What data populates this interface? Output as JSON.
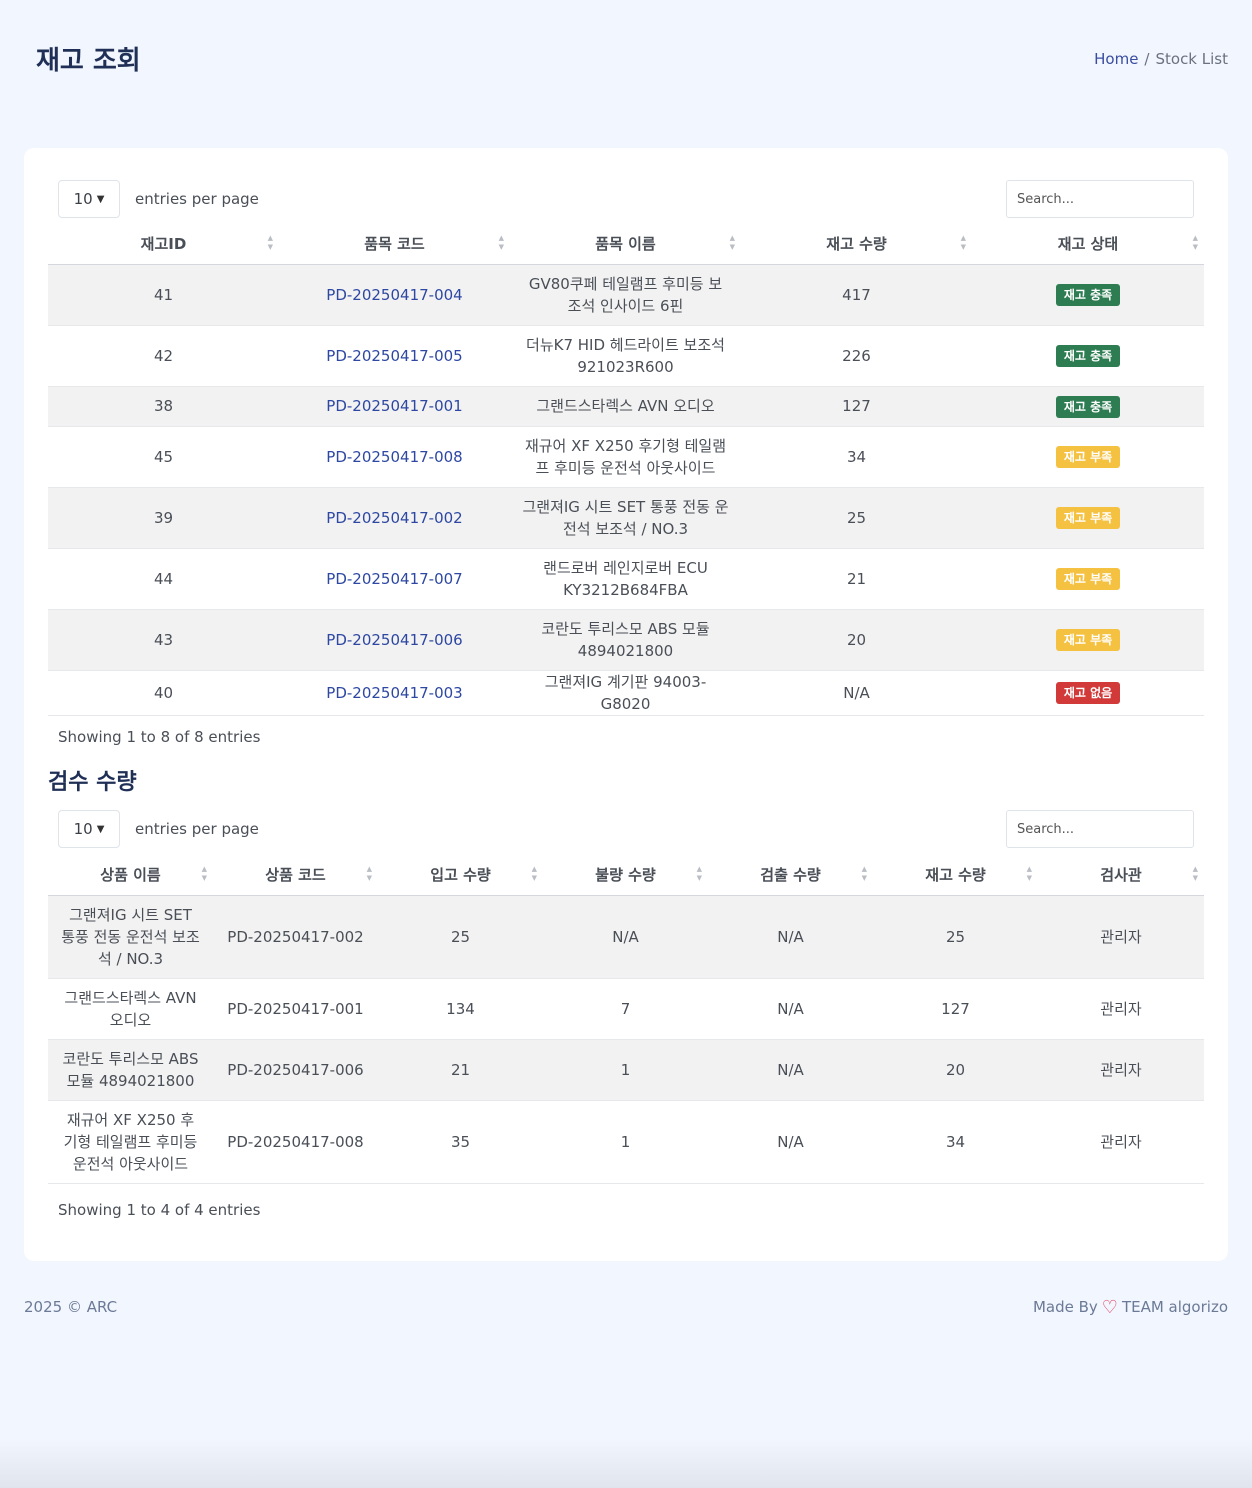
{
  "header": {
    "title": "재고 조회",
    "breadcrumb": {
      "home": "Home",
      "separator": "/",
      "current": "Stock List"
    }
  },
  "stock_table": {
    "length_value": "10",
    "length_label": "entries per page",
    "search_placeholder": "Search...",
    "columns": [
      "재고ID",
      "품목 코드",
      "품목 이름",
      "재고 수량",
      "재고 상태"
    ],
    "rows": [
      {
        "id": "41",
        "code": "PD-20250417-004",
        "name": "GV80쿠페 테일램프 후미등 보조석 인사이드 6핀",
        "qty": "417",
        "status": "재고 충족",
        "status_type": "ok"
      },
      {
        "id": "42",
        "code": "PD-20250417-005",
        "name": "더뉴K7 HID 헤드라이트 보조석 921023R600",
        "qty": "226",
        "status": "재고 충족",
        "status_type": "ok"
      },
      {
        "id": "38",
        "code": "PD-20250417-001",
        "name": "그랜드스타렉스 AVN 오디오",
        "qty": "127",
        "status": "재고 충족",
        "status_type": "ok"
      },
      {
        "id": "45",
        "code": "PD-20250417-008",
        "name": "재규어 XF X250 후기형 테일램프 후미등 운전석 아웃사이드",
        "qty": "34",
        "status": "재고 부족",
        "status_type": "low"
      },
      {
        "id": "39",
        "code": "PD-20250417-002",
        "name": "그랜져IG 시트 SET 통풍 전동 운전석 보조석 / NO.3",
        "qty": "25",
        "status": "재고 부족",
        "status_type": "low"
      },
      {
        "id": "44",
        "code": "PD-20250417-007",
        "name": "랜드로버 레인지로버 ECU KY3212B684FBA",
        "qty": "21",
        "status": "재고 부족",
        "status_type": "low"
      },
      {
        "id": "43",
        "code": "PD-20250417-006",
        "name": "코란도 투리스모 ABS 모듈 4894021800",
        "qty": "20",
        "status": "재고 부족",
        "status_type": "low"
      },
      {
        "id": "40",
        "code": "PD-20250417-003",
        "name": "그랜져IG 계기판 94003-G8020",
        "qty": "N/A",
        "status": "재고 없음",
        "status_type": "none"
      }
    ],
    "info": "Showing 1 to 8 of 8 entries"
  },
  "inspection_section": {
    "title": "검수 수량",
    "length_value": "10",
    "length_label": "entries per page",
    "search_placeholder": "Search...",
    "columns": [
      "상품 이름",
      "상품 코드",
      "입고 수량",
      "불량 수량",
      "검출 수량",
      "재고 수량",
      "검사관"
    ],
    "rows": [
      [
        "그랜져IG 시트 SET 통풍 전동 운전석 보조석 / NO.3",
        "PD-20250417-002",
        "25",
        "N/A",
        "N/A",
        "25",
        "관리자"
      ],
      [
        "그랜드스타렉스 AVN 오디오",
        "PD-20250417-001",
        "134",
        "7",
        "N/A",
        "127",
        "관리자"
      ],
      [
        "코란도 투리스모 ABS 모듈 4894021800",
        "PD-20250417-006",
        "21",
        "1",
        "N/A",
        "20",
        "관리자"
      ],
      [
        "재규어 XF X250 후기형 테일램프 후미등 운전석 아웃사이드",
        "PD-20250417-008",
        "35",
        "1",
        "N/A",
        "34",
        "관리자"
      ]
    ],
    "info": "Showing 1 to 4 of 4 entries"
  },
  "footer": {
    "copyright": "2025 © ARC",
    "made_by": "Made By",
    "heart_icon": "heart-icon",
    "team": "TEAM algorizo"
  },
  "colors": {
    "accent": "#2d47a2",
    "status_ok": "#2e7d52",
    "status_low": "#f5c141",
    "status_none": "#d23a3a"
  }
}
